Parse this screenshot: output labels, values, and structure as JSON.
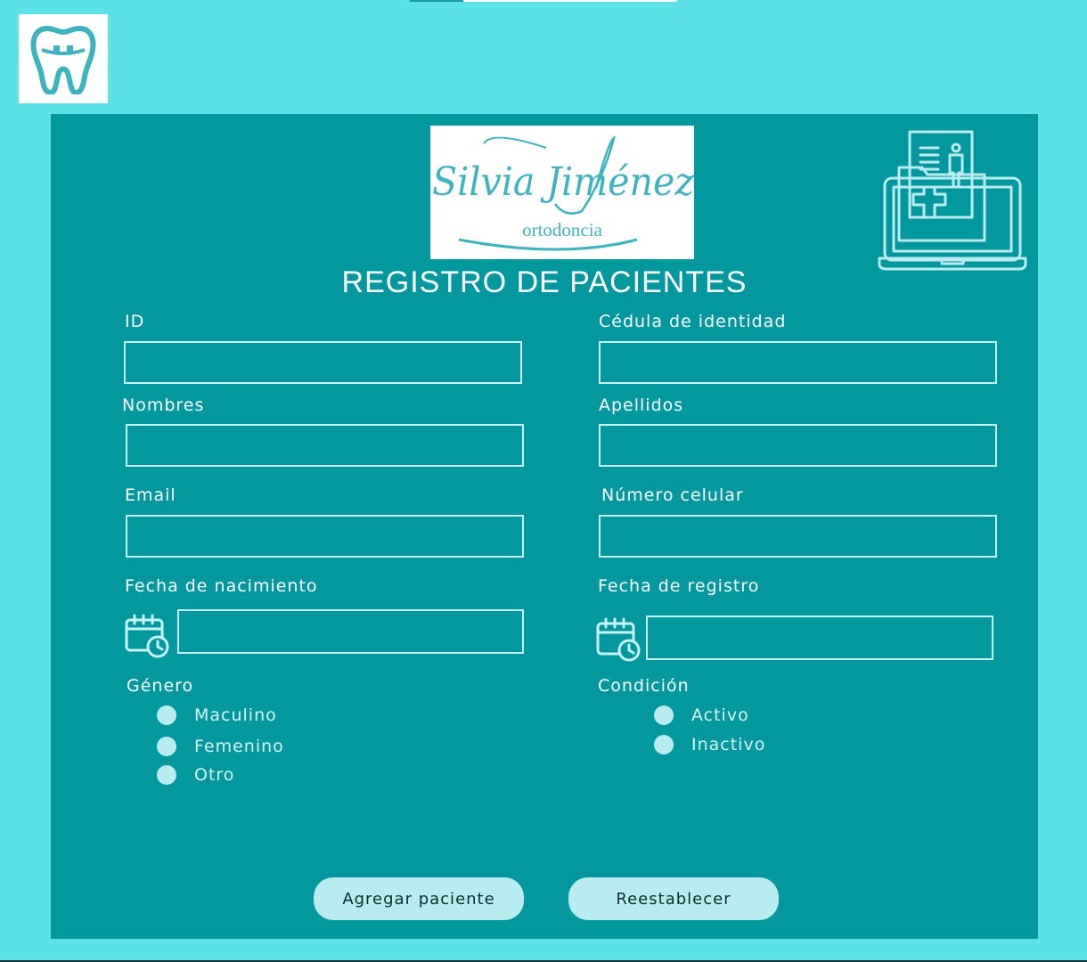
{
  "app": {
    "title": "REGISTRO DE PACIENTES",
    "brand": {
      "name": "Silvia Jiménez",
      "tagline": "ortodoncia"
    },
    "icons": {
      "logo": "tooth-braces-icon",
      "header": "medical-records-laptop-icon",
      "date": "calendar-clock-icon"
    }
  },
  "colors": {
    "page": "#5ce1e6",
    "panel": "#03989e",
    "accent": "#b8ecee",
    "brand_text": "#3eb3c0"
  },
  "form": {
    "id": {
      "label": "ID",
      "value": ""
    },
    "cedula": {
      "label": "Cédula de identidad",
      "value": ""
    },
    "nombres": {
      "label": "Nombres",
      "value": ""
    },
    "apellidos": {
      "label": "Apellidos",
      "value": ""
    },
    "email": {
      "label": "Email",
      "value": ""
    },
    "celular": {
      "label": "Número celular",
      "value": ""
    },
    "fecha_nacimiento": {
      "label": "Fecha de nacimiento",
      "value": ""
    },
    "fecha_registro": {
      "label": "Fecha de registro",
      "value": ""
    },
    "genero": {
      "label": "Género",
      "options": [
        "Maculino",
        "Femenino",
        "Otro"
      ]
    },
    "condicion": {
      "label": "Condición",
      "options": [
        "Activo",
        "Inactivo"
      ]
    }
  },
  "actions": {
    "add": "Agregar paciente",
    "reset": "Reestablecer"
  }
}
